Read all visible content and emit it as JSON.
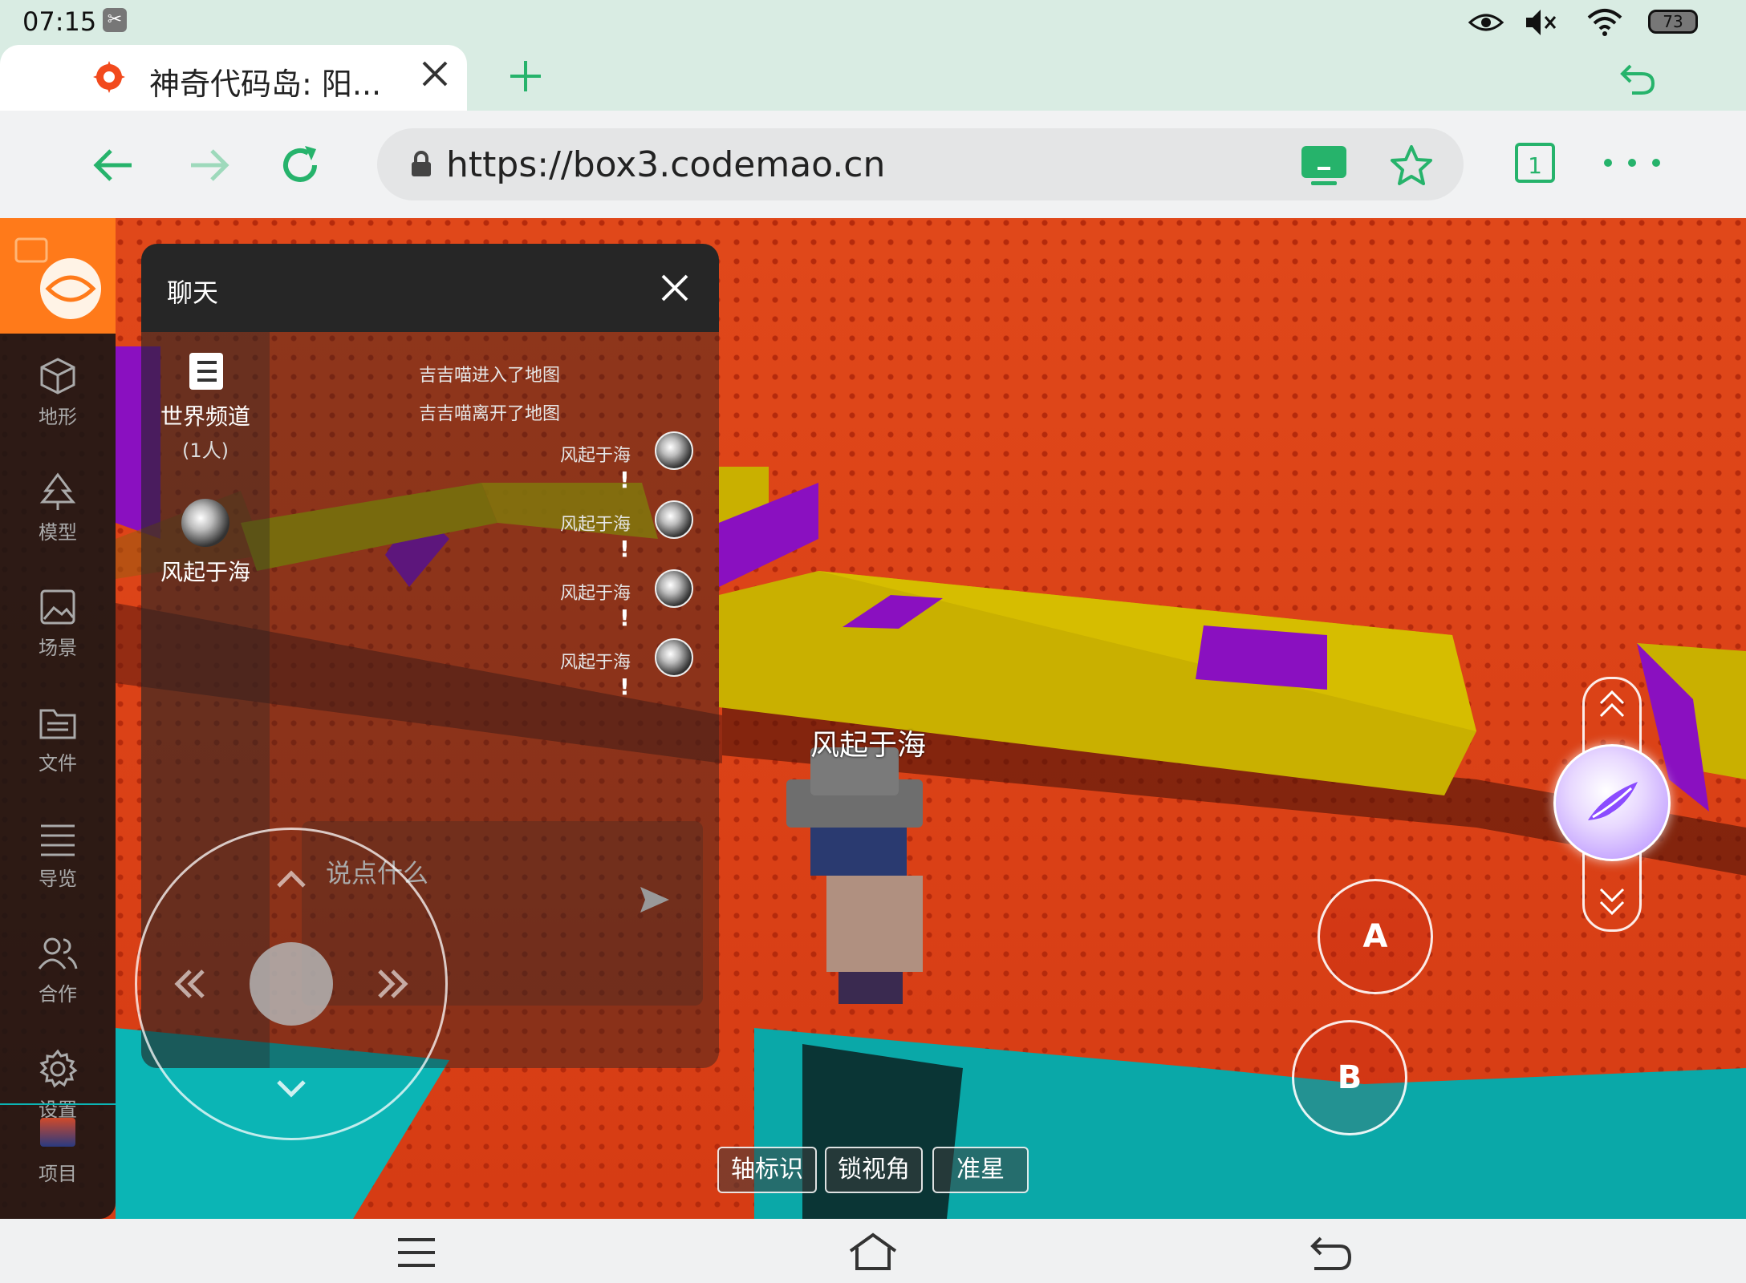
{
  "status_bar": {
    "time": "07:15",
    "battery": "73"
  },
  "tab": {
    "title": "神奇代码岛: 阳..."
  },
  "address_bar": {
    "url": "https://box3.codemao.cn",
    "tab_count": "1"
  },
  "sidebar": {
    "items": [
      {
        "label": "地形",
        "icon": "cube-icon"
      },
      {
        "label": "模型",
        "icon": "tree-icon"
      },
      {
        "label": "场景",
        "icon": "image-icon"
      },
      {
        "label": "文件",
        "icon": "folder-icon"
      },
      {
        "label": "导览",
        "icon": "list-icon"
      },
      {
        "label": "合作",
        "icon": "users-icon"
      },
      {
        "label": "设置",
        "icon": "gear-icon"
      }
    ],
    "project_label": "项目"
  },
  "chat": {
    "title": "聊天",
    "channels": [
      {
        "name": "世界频道",
        "sub": "(1人)"
      },
      {
        "name": "风起于海",
        "sub": ""
      }
    ],
    "system_messages": [
      "吉吉喵进入了地图",
      "吉吉喵离开了地图"
    ],
    "messages": [
      {
        "user": "风起于海",
        "text": "!"
      },
      {
        "user": "风起于海",
        "text": "!"
      },
      {
        "user": "风起于海",
        "text": "!"
      },
      {
        "user": "风起于海",
        "text": "!"
      }
    ],
    "input_placeholder": "说点什么"
  },
  "game": {
    "player_name": "风起于海",
    "buttons": {
      "a": "A",
      "b": "B"
    },
    "bottom_pills": [
      "轴标识",
      "锁视角",
      "准星"
    ]
  },
  "colors": {
    "browser_accent": "#26b36b",
    "sidebar_brand": "#ff7a1a",
    "lava_red": "#d63c14",
    "block_yellow": "#c9b000",
    "block_purple": "#8a10c0",
    "floor_cyan": "#0bb5b5"
  }
}
